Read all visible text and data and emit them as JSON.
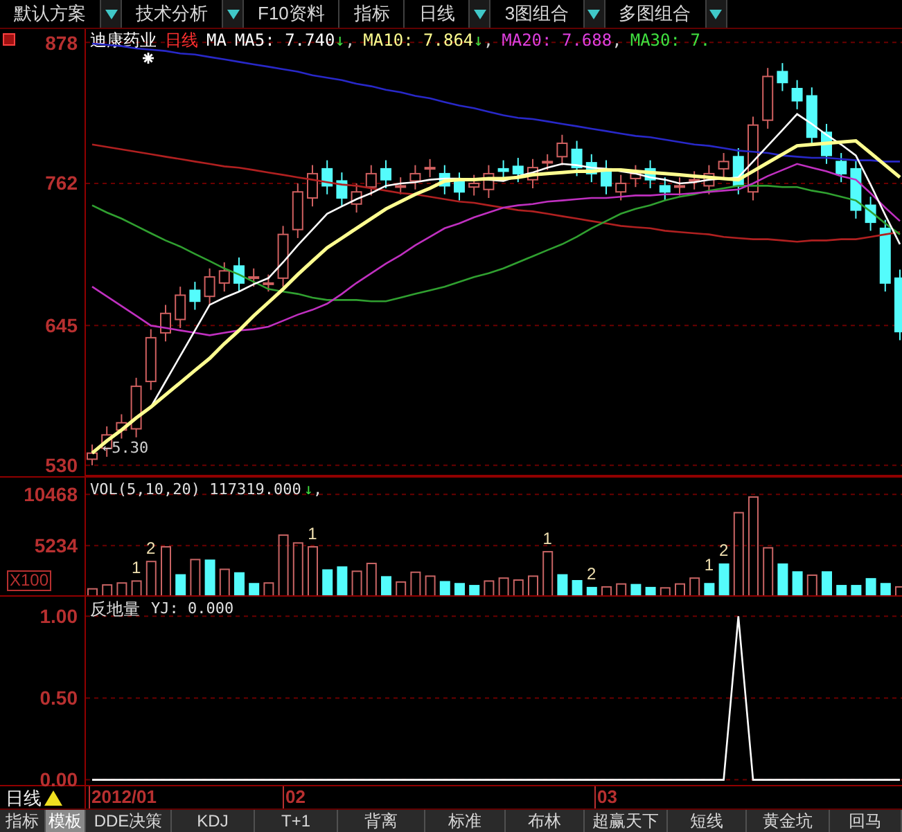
{
  "toolbar": [
    {
      "label": "默认方案",
      "dropdown": true
    },
    {
      "label": "技术分析",
      "dropdown": true
    },
    {
      "label": "F10资料",
      "dropdown": false
    },
    {
      "label": "指标",
      "dropdown": false
    },
    {
      "label": "日线",
      "dropdown": true
    },
    {
      "label": "3图组合",
      "dropdown": true
    },
    {
      "label": "多图组合",
      "dropdown": true
    }
  ],
  "main_chart": {
    "header": [
      {
        "text": "迪康药业",
        "color": "#ffffff"
      },
      {
        "text": "日线",
        "color": "#ff3030"
      },
      {
        "text": "MA",
        "color": "#ffffff"
      },
      {
        "text": "MA5: 7.740",
        "arrow": "↓",
        "separator": ",",
        "color": "#ffffff"
      },
      {
        "text": "MA10: 7.864",
        "arrow": "↓",
        "separator": ",",
        "color": "#ffff90"
      },
      {
        "text": "MA20: 7.688",
        "separator": ",",
        "color": "#e040e0"
      },
      {
        "text": "MA30: 7.",
        "color": "#40e040"
      }
    ],
    "low_label": "←5.30",
    "chart_data": {
      "type": "candlestick",
      "grid": true,
      "ylim": [
        521,
        889
      ],
      "yticks": [
        {
          "value": 878,
          "label": "878"
        },
        {
          "value": 762,
          "label": "762"
        },
        {
          "value": 645,
          "label": "645"
        },
        {
          "value": 530,
          "label": "530"
        }
      ],
      "ohlc": [
        [
          535,
          547,
          530,
          540
        ],
        [
          544,
          562,
          537,
          555
        ],
        [
          559,
          572,
          552,
          565
        ],
        [
          560,
          602,
          553,
          595
        ],
        [
          599,
          642,
          592,
          635
        ],
        [
          639,
          662,
          632,
          655
        ],
        [
          650,
          677,
          643,
          670
        ],
        [
          674,
          681,
          658,
          665
        ],
        [
          669,
          692,
          662,
          685
        ],
        [
          680,
          697,
          673,
          690
        ],
        [
          694,
          701,
          673,
          680
        ],
        [
          684,
          692,
          677,
          685
        ],
        [
          680,
          687,
          673,
          680
        ],
        [
          684,
          727,
          677,
          720
        ],
        [
          724,
          762,
          717,
          755
        ],
        [
          750,
          777,
          743,
          770
        ],
        [
          774,
          781,
          753,
          760
        ],
        [
          764,
          771,
          743,
          750
        ],
        [
          745,
          762,
          738,
          755
        ],
        [
          759,
          777,
          752,
          770
        ],
        [
          774,
          781,
          758,
          765
        ],
        [
          760,
          767,
          753,
          760
        ],
        [
          764,
          777,
          757,
          770
        ],
        [
          774,
          782,
          767,
          775
        ],
        [
          770,
          777,
          753,
          760
        ],
        [
          764,
          771,
          748,
          755
        ],
        [
          759,
          769,
          752,
          762
        ],
        [
          757,
          777,
          750,
          770
        ],
        [
          774,
          781,
          765,
          772
        ],
        [
          776,
          783,
          763,
          770
        ],
        [
          765,
          782,
          758,
          775
        ],
        [
          779,
          786,
          773,
          780
        ],
        [
          784,
          802,
          777,
          795
        ],
        [
          790,
          797,
          768,
          775
        ],
        [
          779,
          786,
          763,
          770
        ],
        [
          774,
          781,
          753,
          760
        ],
        [
          755,
          769,
          748,
          762
        ],
        [
          766,
          777,
          759,
          770
        ],
        [
          774,
          781,
          758,
          765
        ],
        [
          760,
          767,
          748,
          755
        ],
        [
          759,
          767,
          752,
          760
        ],
        [
          764,
          772,
          757,
          765
        ],
        [
          760,
          777,
          753,
          770
        ],
        [
          774,
          787,
          767,
          780
        ],
        [
          784,
          791,
          753,
          760
        ],
        [
          755,
          817,
          748,
          810
        ],
        [
          814,
          857,
          807,
          850
        ],
        [
          854,
          861,
          838,
          845
        ],
        [
          840,
          847,
          823,
          830
        ],
        [
          834,
          841,
          793,
          800
        ],
        [
          804,
          811,
          778,
          785
        ],
        [
          780,
          787,
          763,
          770
        ],
        [
          774,
          781,
          733,
          740
        ],
        [
          744,
          751,
          723,
          730
        ],
        [
          725,
          732,
          673,
          680
        ],
        [
          684,
          691,
          633,
          640
        ]
      ]
    },
    "moving_averages": {
      "chart_data": {
        "type": "line",
        "ylim": [
          521,
          889
        ],
        "series": [
          {
            "color": "#2828c8",
            "values": [
              877,
              876,
              875,
              873,
              872,
              871,
              869,
              868,
              866,
              864,
              862,
              860,
              858,
              856,
              854,
              851,
              849,
              847,
              844,
              842,
              839,
              837,
              834,
              832,
              829,
              826,
              824,
              821,
              818,
              816,
              815,
              813,
              811,
              809,
              807,
              805,
              803,
              801,
              800,
              798,
              796,
              794,
              793,
              791,
              789,
              788,
              787,
              785,
              784,
              783,
              783,
              782,
              781,
              781,
              780,
              780
            ]
          },
          {
            "color": "#b02020",
            "values": [
              794,
              792,
              790,
              788,
              786,
              784,
              782,
              780,
              778,
              776,
              775,
              773,
              771,
              769,
              767,
              765,
              763,
              761,
              760,
              758,
              756,
              754,
              753,
              751,
              749,
              747,
              746,
              744,
              742,
              740,
              739,
              737,
              735,
              733,
              731,
              729,
              727,
              726,
              725,
              723,
              722,
              721,
              720,
              718,
              717,
              716,
              716,
              715,
              714,
              715,
              715,
              716,
              716,
              718,
              720,
              722
            ]
          },
          {
            "color": "#30a030",
            "values": [
              744,
              738,
              733,
              727,
              721,
              715,
              710,
              704,
              698,
              692,
              687,
              681,
              675,
              673,
              671,
              668,
              666,
              666,
              666,
              665,
              665,
              668,
              671,
              674,
              677,
              681,
              685,
              688,
              692,
              697,
              702,
              707,
              712,
              718,
              725,
              731,
              737,
              741,
              744,
              748,
              751,
              753,
              756,
              758,
              760,
              760,
              760,
              759,
              759,
              756,
              754,
              751,
              748,
              739,
              729,
              720
            ]
          },
          {
            "color": "#c030c0",
            "values": [
              677,
              669,
              661,
              653,
              645,
              643,
              641,
              639,
              637,
              639,
              641,
              642,
              644,
              649,
              654,
              658,
              663,
              671,
              680,
              688,
              696,
              703,
              711,
              718,
              725,
              729,
              734,
              738,
              742,
              744,
              745,
              747,
              748,
              749,
              750,
              750,
              751,
              752,
              752,
              753,
              753,
              754,
              755,
              756,
              757,
              762,
              768,
              773,
              778,
              775,
              772,
              768,
              765,
              754,
              742,
              731
            ]
          },
          {
            "color": "#ffffff",
            "values": [
              540,
              550,
              559,
              569,
              578,
              599,
              620,
              641,
              662,
              668,
              673,
              679,
              684,
              697,
              711,
              724,
              737,
              743,
              749,
              754,
              760,
              762,
              763,
              765,
              766,
              766,
              765,
              765,
              764,
              768,
              771,
              775,
              778,
              777,
              775,
              774,
              772,
              770,
              767,
              765,
              762,
              763,
              765,
              766,
              767,
              780,
              793,
              806,
              819,
              811,
              802,
              794,
              785,
              761,
              736,
              712
            ]
          },
          {
            "color": "#ffff90",
            "values": [
              540,
              550,
              559,
              569,
              578,
              588,
              598,
              608,
              618,
              630,
              641,
              653,
              664,
              675,
              687,
              698,
              709,
              717,
              725,
              733,
              741,
              747,
              753,
              758,
              764,
              765,
              765,
              766,
              766,
              767,
              769,
              770,
              771,
              772,
              772,
              773,
              773,
              772,
              771,
              770,
              769,
              768,
              767,
              766,
              765,
              772,
              779,
              786,
              793,
              794,
              795,
              796,
              797,
              787,
              777,
              767
            ]
          }
        ]
      }
    }
  },
  "volume": {
    "header": "VOL(5,10,20) 117319.000",
    "arrow": "↓",
    "separator": ",",
    "chart_data": {
      "type": "bar",
      "grid": true,
      "ylabel": "X100",
      "ylim": [
        0,
        12190
      ],
      "yticks": [
        {
          "value": 5234,
          "label": "5234"
        },
        {
          "value": 10468,
          "label": "10468"
        }
      ],
      "series": [
        {
          "color": "#c86464",
          "values": [
            800,
            1200,
            1400,
            1600,
            3600,
            5100,
            null,
            3800,
            null,
            2800,
            null,
            null,
            1400,
            6300,
            5500,
            5100,
            null,
            null,
            2600,
            3400,
            null,
            1500,
            2500,
            2100,
            null,
            null,
            null,
            1600,
            1900,
            1700,
            2100,
            4600,
            null,
            null,
            null,
            1000,
            1300,
            null,
            null,
            900,
            1300,
            1900,
            null,
            null,
            8600,
            10200,
            5000,
            null,
            null,
            2200,
            null,
            null,
            null,
            null,
            null,
            1000
          ]
        },
        {
          "color": "#54fcfc",
          "values": [
            null,
            null,
            null,
            null,
            null,
            null,
            2300,
            null,
            3800,
            null,
            2500,
            1400,
            null,
            null,
            null,
            null,
            2800,
            3100,
            null,
            null,
            2100,
            null,
            null,
            null,
            1600,
            1400,
            1200,
            null,
            null,
            null,
            null,
            null,
            2300,
            1700,
            1000,
            null,
            null,
            1300,
            1000,
            null,
            null,
            null,
            1400,
            3400,
            null,
            null,
            null,
            3400,
            2600,
            null,
            2600,
            1200,
            1200,
            1900,
            1400,
            null
          ]
        }
      ],
      "annotations": [
        {
          "text": "1"
        },
        {
          "text": "2"
        },
        {
          "text": "1"
        },
        {
          "text": "1"
        },
        {
          "text": "2"
        },
        {
          "text": "1"
        },
        {
          "text": "2"
        }
      ]
    }
  },
  "indicator": {
    "name": "反地量",
    "reading": "YJ: 0.000",
    "chart_data": {
      "type": "line",
      "grid": true,
      "ylim": [
        -0.04,
        1.12
      ],
      "yticks": [
        {
          "value": 0,
          "label": "0.00"
        },
        {
          "value": 0.5,
          "label": "0.50"
        },
        {
          "value": 1,
          "label": "1.00"
        }
      ],
      "series": [
        {
          "color": "#ffffff",
          "values": [
            0,
            0,
            0,
            0,
            0,
            0,
            0,
            0,
            0,
            0,
            0,
            0,
            0,
            0,
            0,
            0,
            0,
            0,
            0,
            0,
            0,
            0,
            0,
            0,
            0,
            0,
            0,
            0,
            0,
            0,
            0,
            0,
            0,
            0,
            0,
            0,
            0,
            0,
            0,
            0,
            0,
            0,
            0,
            0,
            1,
            0,
            0,
            0,
            0,
            0,
            0,
            0,
            0,
            0,
            0,
            0
          ]
        }
      ]
    }
  },
  "date_axis": {
    "period": "日线",
    "dates": [
      "2012/01",
      "02",
      "03"
    ]
  },
  "tabs": [
    {
      "label": "指标",
      "selected": false
    },
    {
      "label": "模板",
      "selected": true
    },
    {
      "label": "DDE决策",
      "selected": false
    },
    {
      "label": "KDJ",
      "selected": false
    },
    {
      "label": "T+1",
      "selected": false
    },
    {
      "label": "背离",
      "selected": false
    },
    {
      "label": "标准",
      "selected": false
    },
    {
      "label": "布林",
      "selected": false
    },
    {
      "label": "超赢天下",
      "selected": false
    },
    {
      "label": "短线",
      "selected": false
    },
    {
      "label": "黄金坑",
      "selected": false
    },
    {
      "label": "回马",
      "selected": false
    }
  ]
}
